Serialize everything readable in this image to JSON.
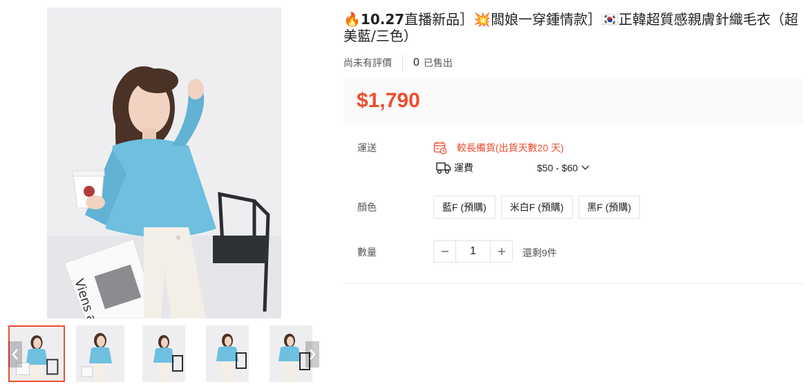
{
  "product": {
    "title_emoji_fire": "🔥",
    "title_part1": "10.27",
    "title_part2": "直播新品］",
    "title_emoji_boom": "💥",
    "title_part3": "闆娘一穿鍾情款］",
    "title_emoji_flag": "🇰🇷",
    "title_part4": "正韓超質感親膚針織毛衣（超美藍/三色）"
  },
  "rating": {
    "no_rating_text": "尚未有評價",
    "sold_count": "0",
    "sold_label": "已售出"
  },
  "price": "$1,790",
  "shipping": {
    "label": "運送",
    "preorder_text": "較長備貨(出貨天數20 天)",
    "fee_label": "運費",
    "fee_value": "$50 - $60"
  },
  "color": {
    "label": "顏色",
    "options": [
      "藍F (預購)",
      "米白F (預購)",
      "黑F (預購)"
    ]
  },
  "quantity": {
    "label": "數量",
    "value": "1",
    "stock_text": "還剩9件"
  },
  "gallery": {
    "selected_index": 0,
    "thumbnail_count": 5
  },
  "colors": {
    "accent": "#ee4d2d",
    "sweater": "#6fbfdf"
  }
}
